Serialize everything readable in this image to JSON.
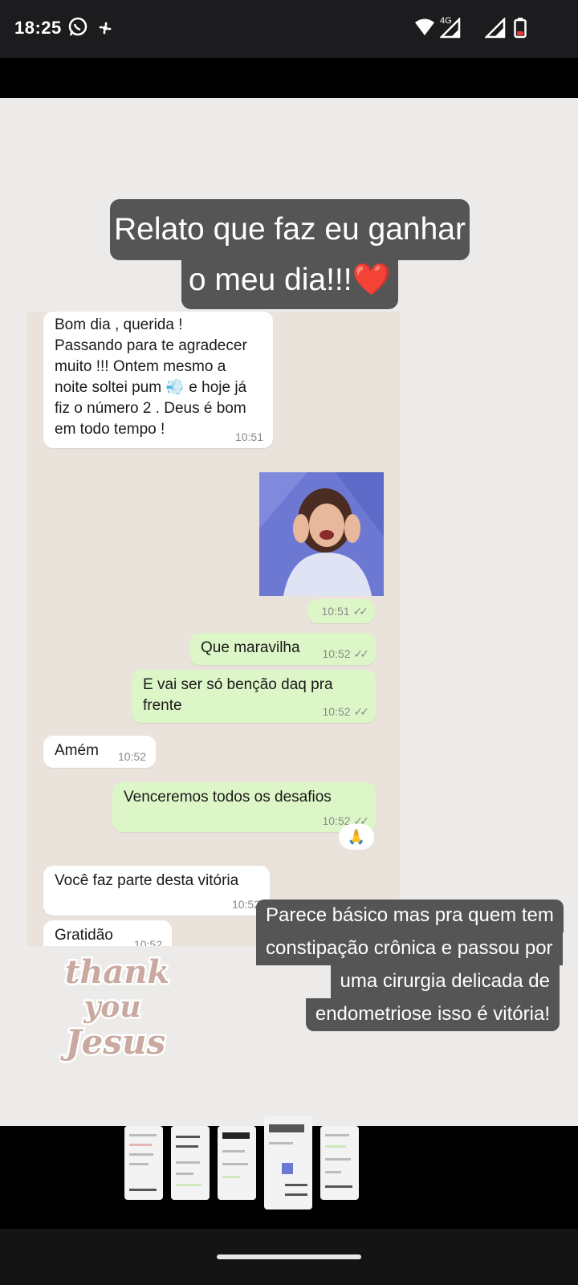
{
  "status_bar": {
    "time": "18:25",
    "network": "4G",
    "icons_left": [
      "whatsapp-icon",
      "fan-icon"
    ],
    "icons_right": [
      "wifi-icon",
      "signal-icon",
      "signal-icon",
      "battery-low-icon"
    ]
  },
  "story": {
    "caption_top_line1": "Relato que faz eu ganhar",
    "caption_top_line2": "o meu dia!!!❤️",
    "caption_bottom": [
      "Parece básico mas pra quem tem",
      "constipação crônica e passou por",
      "uma cirurgia delicada de",
      "endometriose isso é vitória!"
    ],
    "sticker_text": [
      "thank",
      "you",
      "Jesus"
    ]
  },
  "chat": {
    "messages": [
      {
        "dir": "in",
        "text": "Bom dia , querida !\nPassando para te agradecer muito !!! Ontem mesmo a noite soltei pum 💨 e hoje já fiz o número 2 . Deus é bom em todo tempo !",
        "time": "10:51"
      },
      {
        "dir": "out",
        "type": "image",
        "time": "10:51"
      },
      {
        "dir": "out",
        "text": "Que maravilha",
        "time": "10:52"
      },
      {
        "dir": "out",
        "text": "E vai ser só benção daq pra frente",
        "time": "10:52"
      },
      {
        "dir": "in",
        "text": "Amém",
        "time": "10:52"
      },
      {
        "dir": "out",
        "text": "Venceremos todos os desafios",
        "time": "10:52"
      },
      {
        "dir": "in",
        "text": "Você faz parte desta vitória",
        "time": "10:52"
      },
      {
        "dir": "in",
        "text": "Gratidão",
        "time": "10:52"
      }
    ],
    "reaction": "🙏"
  },
  "colors": {
    "caption_bg": "#555555",
    "chat_bg": "#eae3dc",
    "bubble_out": "#dcf6c7",
    "bubble_in": "#ffffff",
    "story_bg": "#ecebe9"
  }
}
